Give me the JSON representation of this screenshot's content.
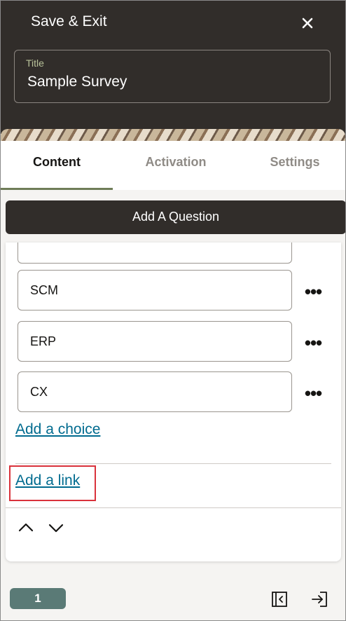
{
  "header": {
    "save_exit_label": "Save & Exit",
    "close_icon": "close-icon",
    "title_label": "Title",
    "title_value": "Sample Survey"
  },
  "tabs": [
    {
      "label": "Content",
      "active": true
    },
    {
      "label": "Activation",
      "active": false
    },
    {
      "label": "Settings",
      "active": false
    }
  ],
  "add_question_label": "Add A Question",
  "choices": [
    "SCM",
    "ERP",
    "CX"
  ],
  "add_choice_label": "Add a choice",
  "add_link_label": "Add a link",
  "footer": {
    "page_number": "1"
  },
  "colors": {
    "header_bg": "#312d2a",
    "accent_tab": "#6f7d58",
    "link": "#006b8f",
    "page_pill": "#5a7a76",
    "highlight": "#d9323b"
  }
}
